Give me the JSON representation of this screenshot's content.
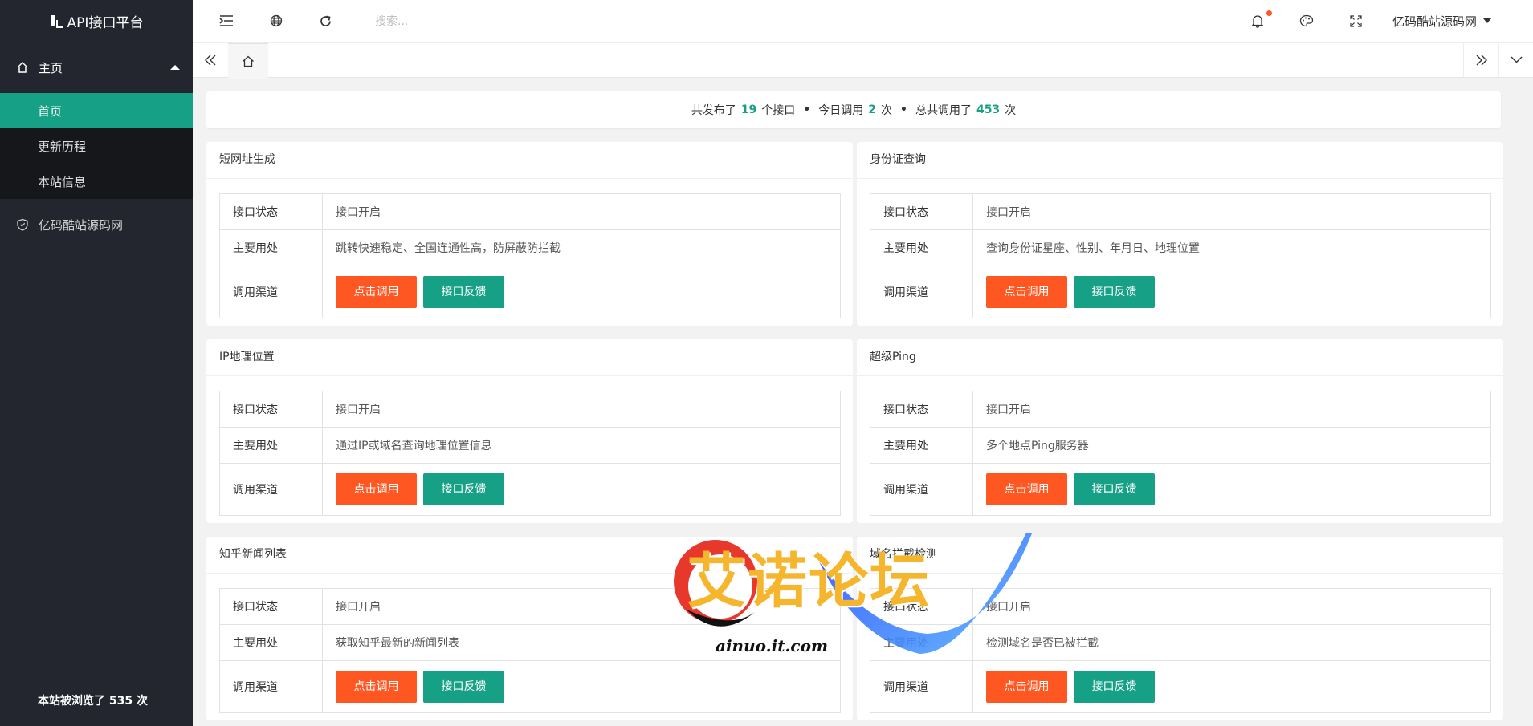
{
  "app": {
    "logo_text": "API接口平台"
  },
  "sidebar": {
    "group_label": "主页",
    "items": [
      {
        "label": "首页"
      },
      {
        "label": "更新历程"
      },
      {
        "label": "本站信息"
      }
    ],
    "site_label": "亿码酷站源码网",
    "visits_text": "本站被浏览了 535 次"
  },
  "header": {
    "search_placeholder": "搜索...",
    "user_name": "亿码酷站源码网"
  },
  "summary": {
    "part1": "共发布了",
    "published": "19",
    "part2": "个接口",
    "part3": "今日调用",
    "today": "2",
    "part4": "次",
    "part5": "总共调用了",
    "total": "453",
    "part6": "次",
    "sep": "•"
  },
  "labels": {
    "status": "接口状态",
    "usage": "主要用处",
    "channel": "调用渠道",
    "call_btn": "点击调用",
    "feedback_btn": "接口反馈"
  },
  "cards": [
    {
      "title": "短网址生成",
      "status": "接口开启",
      "usage": "跳转快速稳定、全国连通性高，防屏蔽防拦截"
    },
    {
      "title": "身份证查询",
      "status": "接口开启",
      "usage": "查询身份证星座、性别、年月日、地理位置"
    },
    {
      "title": "IP地理位置",
      "status": "接口开启",
      "usage": "通过IP或域名查询地理位置信息"
    },
    {
      "title": "超级Ping",
      "status": "接口开启",
      "usage": "多个地点Ping服务器"
    },
    {
      "title": "知乎新闻列表",
      "status": "接口开启",
      "usage": "获取知乎最新的新闻列表"
    },
    {
      "title": "域名拦截检测",
      "status": "接口开启",
      "usage": "检测域名是否已被拦截"
    }
  ],
  "watermark": {
    "text": "艾诺论坛",
    "url": "ainuo.it.com"
  },
  "colors": {
    "sidebar_bg": "#23262e",
    "accent": "#16a085",
    "orange": "#ff5722"
  }
}
